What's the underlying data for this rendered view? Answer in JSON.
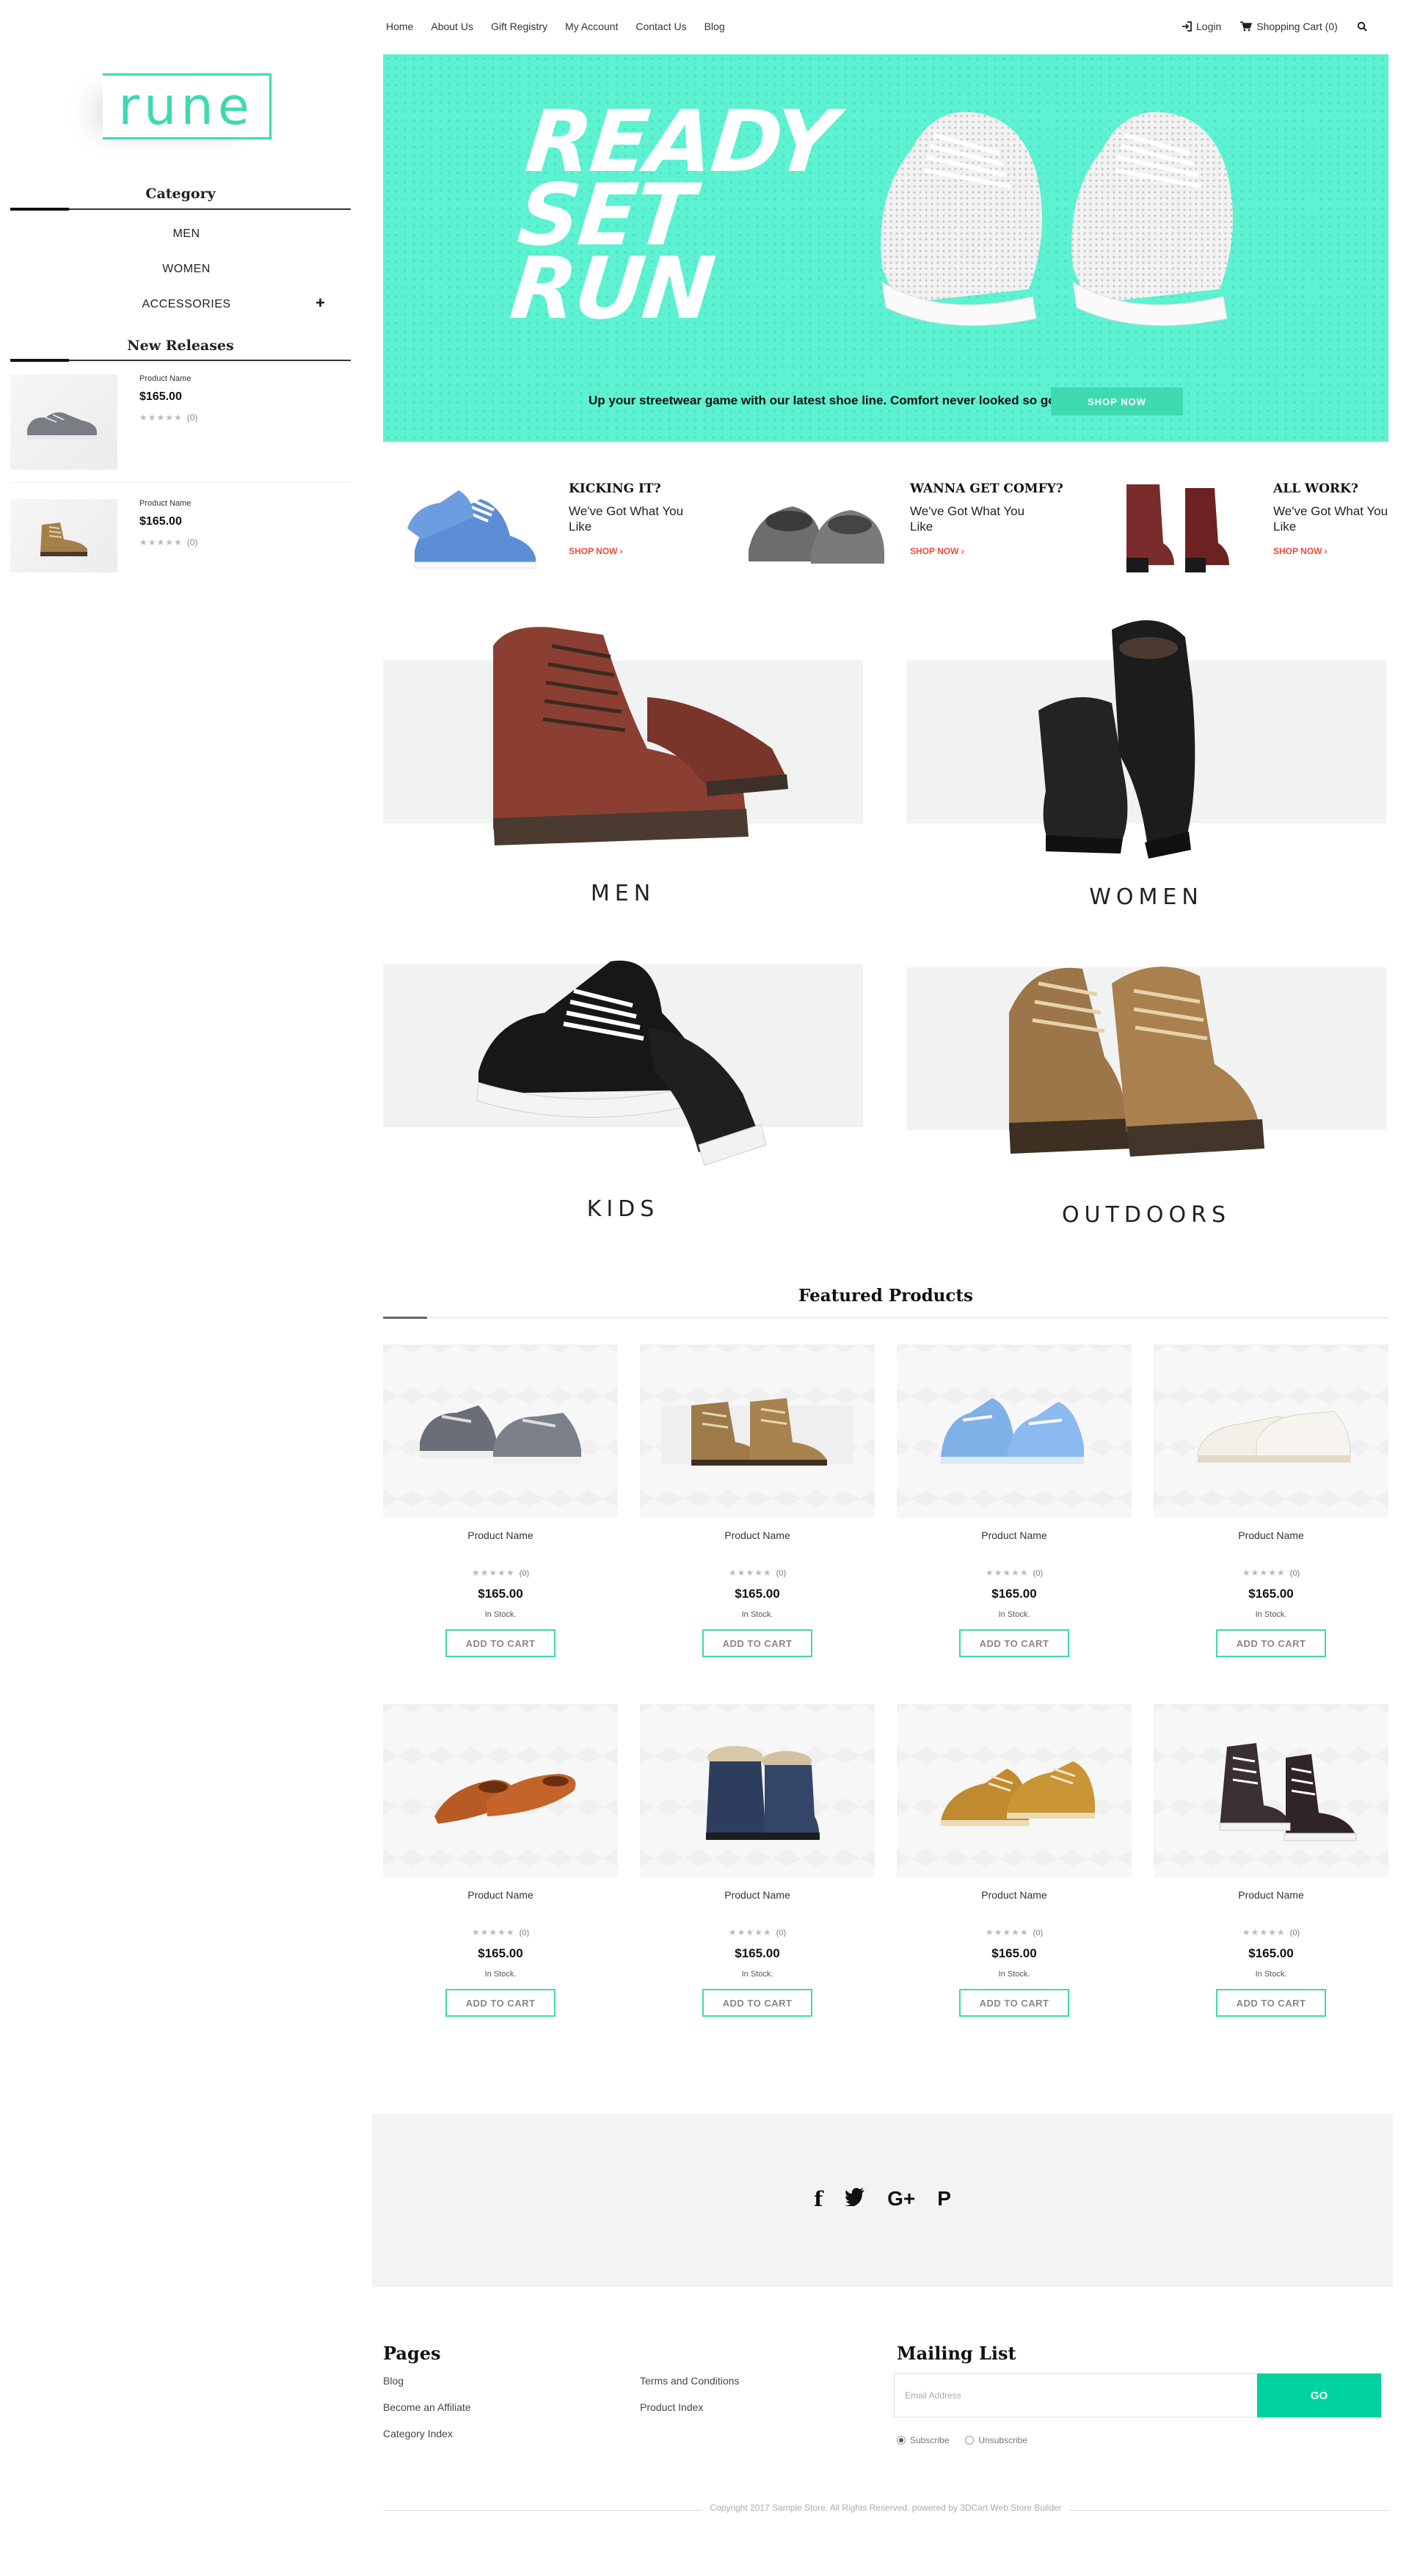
{
  "brand": {
    "logo_text": "rune",
    "accent_color": "#3fd9b0"
  },
  "nav": {
    "links": [
      "Home",
      "About Us",
      "Gift Registry",
      "My Account",
      "Contact Us",
      "Blog"
    ],
    "login": "Login",
    "cart": "Shopping Cart (0)"
  },
  "sidebar": {
    "category_title": "Category",
    "categories": [
      {
        "label": "MEN"
      },
      {
        "label": "WOMEN"
      },
      {
        "label": "ACCESSORIES"
      }
    ],
    "new_releases_title": "New Releases",
    "new_releases": [
      {
        "name": "Product Name",
        "price": "$165.00",
        "stars": "★★★★★",
        "count": "(0)"
      },
      {
        "name": "Product Name",
        "price": "$165.00",
        "stars": "★★★★★",
        "count": "(0)"
      }
    ]
  },
  "hero": {
    "title_lines": [
      "READY",
      "SET",
      "RUN"
    ],
    "subtitle": "Up your streetwear game with our latest shoe line. Comfort never looked so good.",
    "button": "SHOP NOW"
  },
  "promos": [
    {
      "title": "KICKING IT?",
      "text": "We've Got What You Like",
      "link": "SHOP NOW ›"
    },
    {
      "title": "WANNA GET COMFY?",
      "text": "We've Got What You Like",
      "link": "SHOP NOW ›"
    },
    {
      "title": "ALL WORK?",
      "text": "We've Got What You Like",
      "link": "SHOP NOW ›"
    }
  ],
  "categories": [
    {
      "label": "MEN"
    },
    {
      "label": "WOMEN"
    },
    {
      "label": "KIDS"
    },
    {
      "label": "OUTDOORS"
    }
  ],
  "featured": {
    "title": "Featured Products",
    "products": [
      {
        "name": "Product Name",
        "stars": "★★★★★",
        "count": "(0)",
        "price": "$165.00",
        "stock": "In Stock.",
        "button": "ADD TO CART"
      },
      {
        "name": "Product Name",
        "stars": "★★★★★",
        "count": "(0)",
        "price": "$165.00",
        "stock": "In Stock.",
        "button": "ADD TO CART"
      },
      {
        "name": "Product Name",
        "stars": "★★★★★",
        "count": "(0)",
        "price": "$165.00",
        "stock": "In Stock.",
        "button": "ADD TO CART"
      },
      {
        "name": "Product Name",
        "stars": "★★★★★",
        "count": "(0)",
        "price": "$165.00",
        "stock": "In Stock.",
        "button": "ADD TO CART"
      },
      {
        "name": "Product Name",
        "stars": "★★★★★",
        "count": "(0)",
        "price": "$165.00",
        "stock": "In Stock.",
        "button": "ADD TO CART"
      },
      {
        "name": "Product Name",
        "stars": "★★★★★",
        "count": "(0)",
        "price": "$165.00",
        "stock": "In Stock.",
        "button": "ADD TO CART"
      },
      {
        "name": "Product Name",
        "stars": "★★★★★",
        "count": "(0)",
        "price": "$165.00",
        "stock": "In Stock.",
        "button": "ADD TO CART"
      },
      {
        "name": "Product Name",
        "stars": "★★★★★",
        "count": "(0)",
        "price": "$165.00",
        "stock": "In Stock.",
        "button": "ADD TO CART"
      }
    ]
  },
  "social": {
    "icons": [
      "facebook-icon",
      "twitter-icon",
      "google-plus-icon",
      "pinterest-icon"
    ],
    "glyphs": [
      "f",
      "🐦",
      "G+",
      "P"
    ]
  },
  "footer": {
    "pages_title": "Pages",
    "pages_col1": [
      "Blog",
      "Become an Affiliate",
      "Category Index"
    ],
    "pages_col2": [
      "Terms and Conditions",
      "Product Index"
    ],
    "mailing_title": "Mailing List",
    "email_placeholder": "Email Address",
    "go_button": "GO",
    "subscribe": "Subscribe",
    "unsubscribe": "Unsubscribe",
    "copyright": "Copyright 2017 Sample Store. All Rights Reserved. powered by 3DCart Web Store Builder"
  }
}
